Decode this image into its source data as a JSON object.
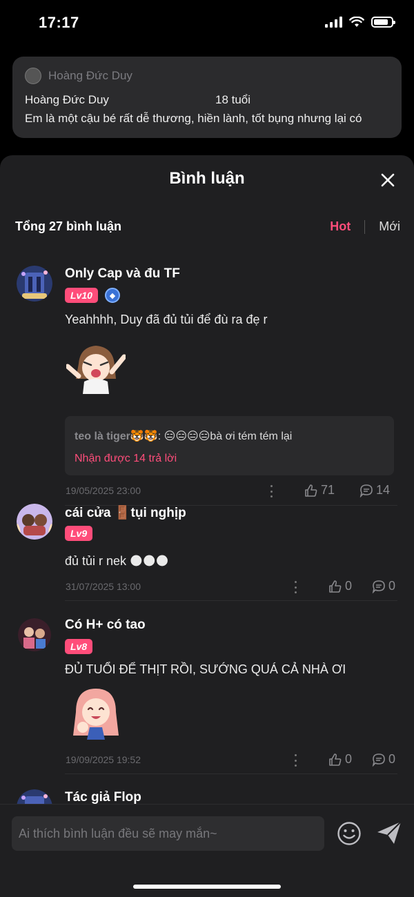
{
  "status_bar": {
    "time": "17:17",
    "battery_level": 0.85
  },
  "preview": {
    "author": "Hoàng Đức Duy",
    "name": "Hoàng Đức Duy",
    "age": "18 tuổi",
    "description": "Em là một cậu bé rất dễ thương, hiền lành, tốt bụng nhưng lại có"
  },
  "sheet": {
    "title": "Bình luận",
    "total": "Tổng 27 bình luận",
    "sort": {
      "hot": "Hot",
      "new": "Mới"
    }
  },
  "comments": [
    {
      "name": "Only Cap và đu TF",
      "level": "Lv10",
      "text": "Yeahhhh, Duy đã đủ tủi để đù ra đẹ r",
      "reply_user": "teo là tiger🐯🐯",
      "reply_text": ": 😑😑😑😑bà ơi tém tém lại",
      "reply_more": "Nhận được 14 trả lời",
      "date": "19/05/2025 23:00",
      "likes": "71",
      "replies": "14"
    },
    {
      "name": "cái cửa 🚪tụi nghịp",
      "level": "Lv9",
      "text": "đủ tủi r nek 🌑🌑🌑",
      "date": "31/07/2025 13:00",
      "likes": "0",
      "replies": "0"
    },
    {
      "name": "Có H+ có tao",
      "level": "Lv8",
      "text": "ĐỦ TUỔI ĐỂ THỊT RỒI, SƯỚNG QUÁ CẢ NHÀ ƠI",
      "date": "19/09/2025 19:52",
      "likes": "0",
      "replies": "0"
    },
    {
      "name": "Tác giả Flop"
    }
  ],
  "composer": {
    "placeholder": "Ai thích bình luận đều sẽ may mắn~"
  },
  "colors": {
    "accent": "#ff4d7a",
    "sheet_bg": "#1f1f21",
    "card_bg": "#2b2b2d"
  }
}
